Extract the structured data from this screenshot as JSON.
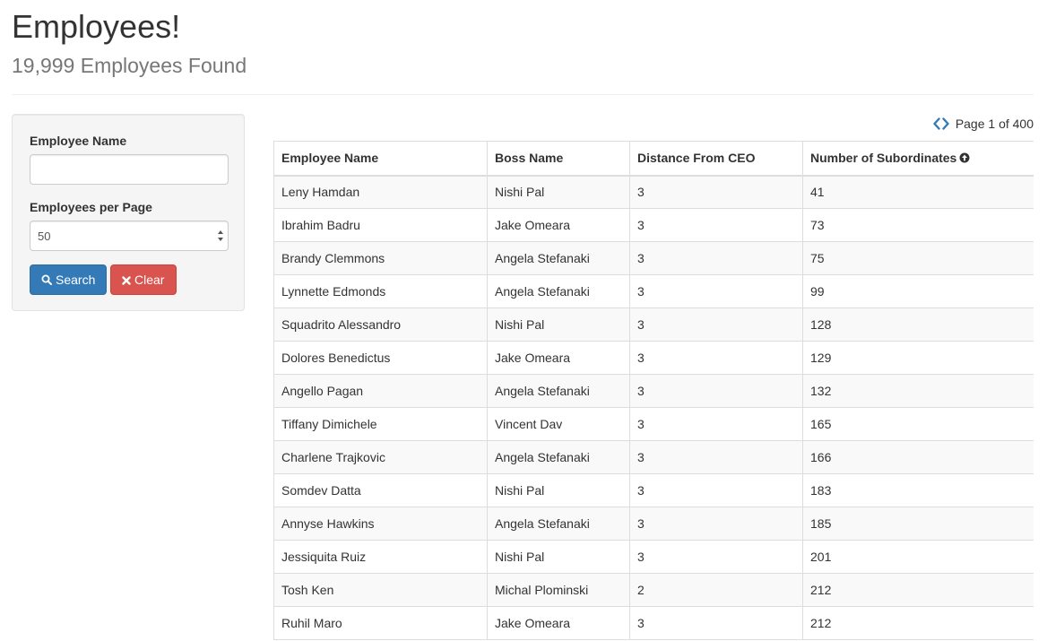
{
  "header": {
    "title": "Employees!",
    "subtitle": "19,999 Employees Found"
  },
  "filters": {
    "name_label": "Employee Name",
    "name_value": "",
    "name_placeholder": "",
    "per_page_label": "Employees per Page",
    "per_page_value": "50",
    "search_label": "Search",
    "clear_label": "Clear"
  },
  "pager": {
    "text": "Page 1 of 400"
  },
  "table": {
    "columns": [
      "Employee Name",
      "Boss Name",
      "Distance From CEO",
      "Number of Subordinates"
    ],
    "sort_column": "Number of Subordinates",
    "sort_direction": "ascending",
    "rows": [
      [
        "Leny Hamdan",
        "Nishi Pal",
        "3",
        "41"
      ],
      [
        "Ibrahim Badru",
        "Jake Omeara",
        "3",
        "73"
      ],
      [
        "Brandy Clemmons",
        "Angela Stefanaki",
        "3",
        "75"
      ],
      [
        "Lynnette Edmonds",
        "Angela Stefanaki",
        "3",
        "99"
      ],
      [
        "Squadrito Alessandro",
        "Nishi Pal",
        "3",
        "128"
      ],
      [
        "Dolores Benedictus",
        "Jake Omeara",
        "3",
        "129"
      ],
      [
        "Angello Pagan",
        "Angela Stefanaki",
        "3",
        "132"
      ],
      [
        "Tiffany Dimichele",
        "Vincent Dav",
        "3",
        "165"
      ],
      [
        "Charlene Trajkovic",
        "Angela Stefanaki",
        "3",
        "166"
      ],
      [
        "Somdev Datta",
        "Nishi Pal",
        "3",
        "183"
      ],
      [
        "Annyse Hawkins",
        "Angela Stefanaki",
        "3",
        "185"
      ],
      [
        "Jessiquita Ruiz",
        "Nishi Pal",
        "3",
        "201"
      ],
      [
        "Tosh Ken",
        "Michal Plominski",
        "2",
        "212"
      ],
      [
        "Ruhil Maro",
        "Jake Omeara",
        "3",
        "212"
      ]
    ]
  },
  "icons": {
    "search": "search-icon",
    "clear": "times-icon",
    "prev": "chevron-left-icon",
    "next": "chevron-right-icon",
    "sort": "arrow-circle-up-icon",
    "select": "select-arrows-icon"
  },
  "colors": {
    "primary": "#337ab7",
    "danger": "#d9534f",
    "subtitle": "#777777",
    "panel_bg": "#f5f5f5",
    "stripe": "#f9f9f9"
  }
}
